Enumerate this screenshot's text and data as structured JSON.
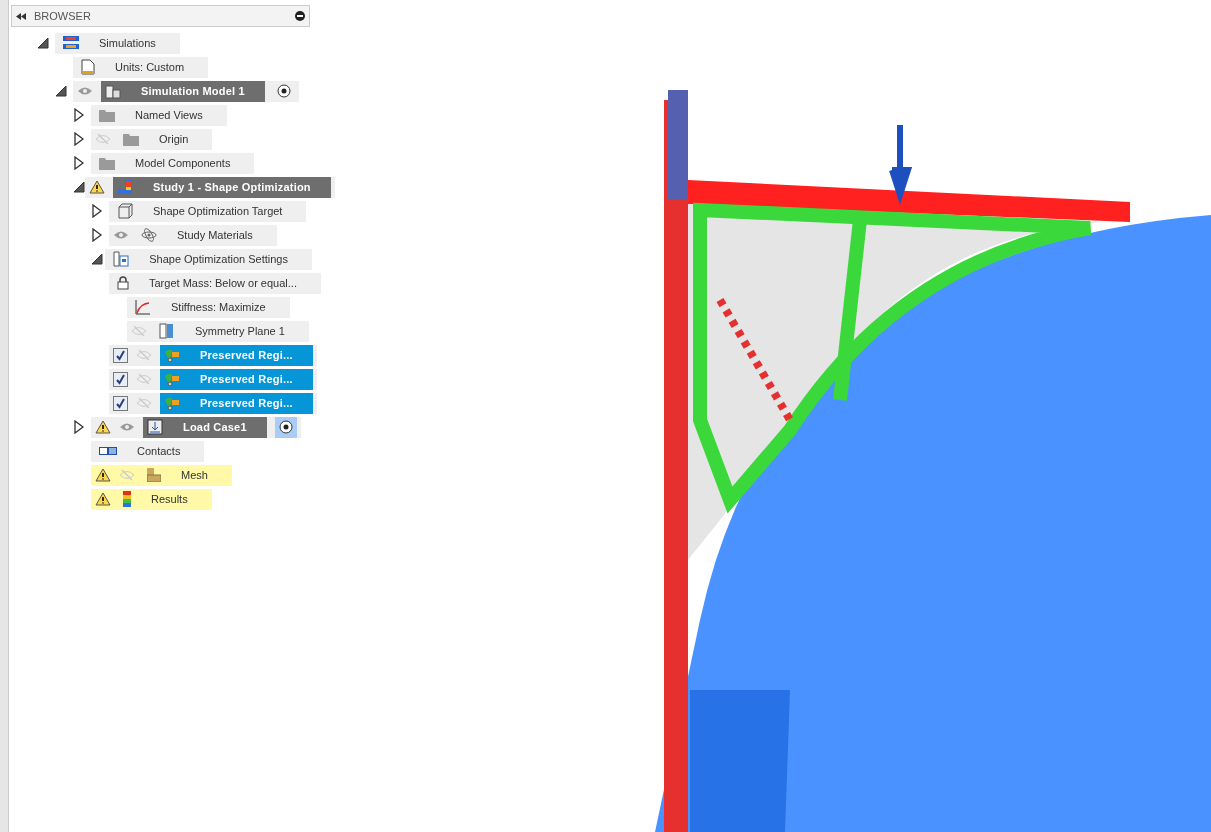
{
  "browser": {
    "title": "BROWSER"
  },
  "tree": [
    {
      "label": "Simulations",
      "kind": "simulations",
      "expanded": true,
      "warning": false,
      "current": false,
      "selected": false,
      "children": [
        {
          "label": "Units: Custom",
          "kind": "units",
          "warning": false,
          "current": false,
          "selected": false
        },
        {
          "label": "Simulation Model 1",
          "kind": "model",
          "expanded": true,
          "visible": true,
          "warning": false,
          "current": true,
          "selected": false,
          "active": true,
          "children": [
            {
              "label": "Named Views",
              "kind": "folder",
              "expanded": false,
              "warning": false,
              "current": false,
              "selected": false
            },
            {
              "label": "Origin",
              "kind": "folder",
              "expanded": false,
              "visible": false,
              "warning": false,
              "current": false,
              "selected": false
            },
            {
              "label": "Model Components",
              "kind": "folder",
              "expanded": false,
              "warning": false,
              "current": false,
              "selected": false
            },
            {
              "label": "Study 1 - Shape Optimization",
              "kind": "study",
              "expanded": true,
              "warning": true,
              "current": true,
              "selected": false,
              "children": [
                {
                  "label": "Shape Optimization Target",
                  "kind": "box",
                  "expanded": false,
                  "warning": false,
                  "current": false,
                  "selected": false
                },
                {
                  "label": "Study Materials",
                  "kind": "materials",
                  "expanded": false,
                  "visible": true,
                  "warning": false,
                  "current": false,
                  "selected": false
                },
                {
                  "label": "Shape Optimization Settings",
                  "kind": "settings",
                  "expanded": true,
                  "warning": false,
                  "current": false,
                  "selected": false,
                  "children": [
                    {
                      "label": "Target Mass: Below or equal...",
                      "kind": "lock",
                      "warning": false,
                      "current": false,
                      "selected": false
                    },
                    {
                      "label": "Stiffness: Maximize",
                      "kind": "curve",
                      "warning": false,
                      "current": false,
                      "selected": false
                    },
                    {
                      "label": "Symmetry Plane 1",
                      "kind": "plane",
                      "visible": false,
                      "warning": false,
                      "current": false,
                      "selected": false
                    },
                    {
                      "label": "Preserved Regi...",
                      "kind": "preserve",
                      "checked": true,
                      "visible": false,
                      "warning": false,
                      "current": false,
                      "selected": true
                    },
                    {
                      "label": "Preserved Regi...",
                      "kind": "preserve",
                      "checked": true,
                      "visible": false,
                      "warning": false,
                      "current": false,
                      "selected": true
                    },
                    {
                      "label": "Preserved Regi...",
                      "kind": "preserve",
                      "checked": true,
                      "visible": false,
                      "warning": false,
                      "current": false,
                      "selected": true
                    }
                  ]
                }
              ]
            },
            {
              "label": "Load Case1",
              "kind": "load",
              "expanded": false,
              "visible": true,
              "warning": true,
              "current": true,
              "selected": false,
              "active": true
            },
            {
              "label": "Contacts",
              "kind": "contacts",
              "warning": false,
              "current": false,
              "selected": false
            },
            {
              "label": "Mesh",
              "kind": "mesh",
              "visible": false,
              "warning": true,
              "current": false,
              "selected": false
            },
            {
              "label": "Results",
              "kind": "results",
              "warning": true,
              "current": false,
              "selected": false
            }
          ]
        }
      ]
    }
  ]
}
